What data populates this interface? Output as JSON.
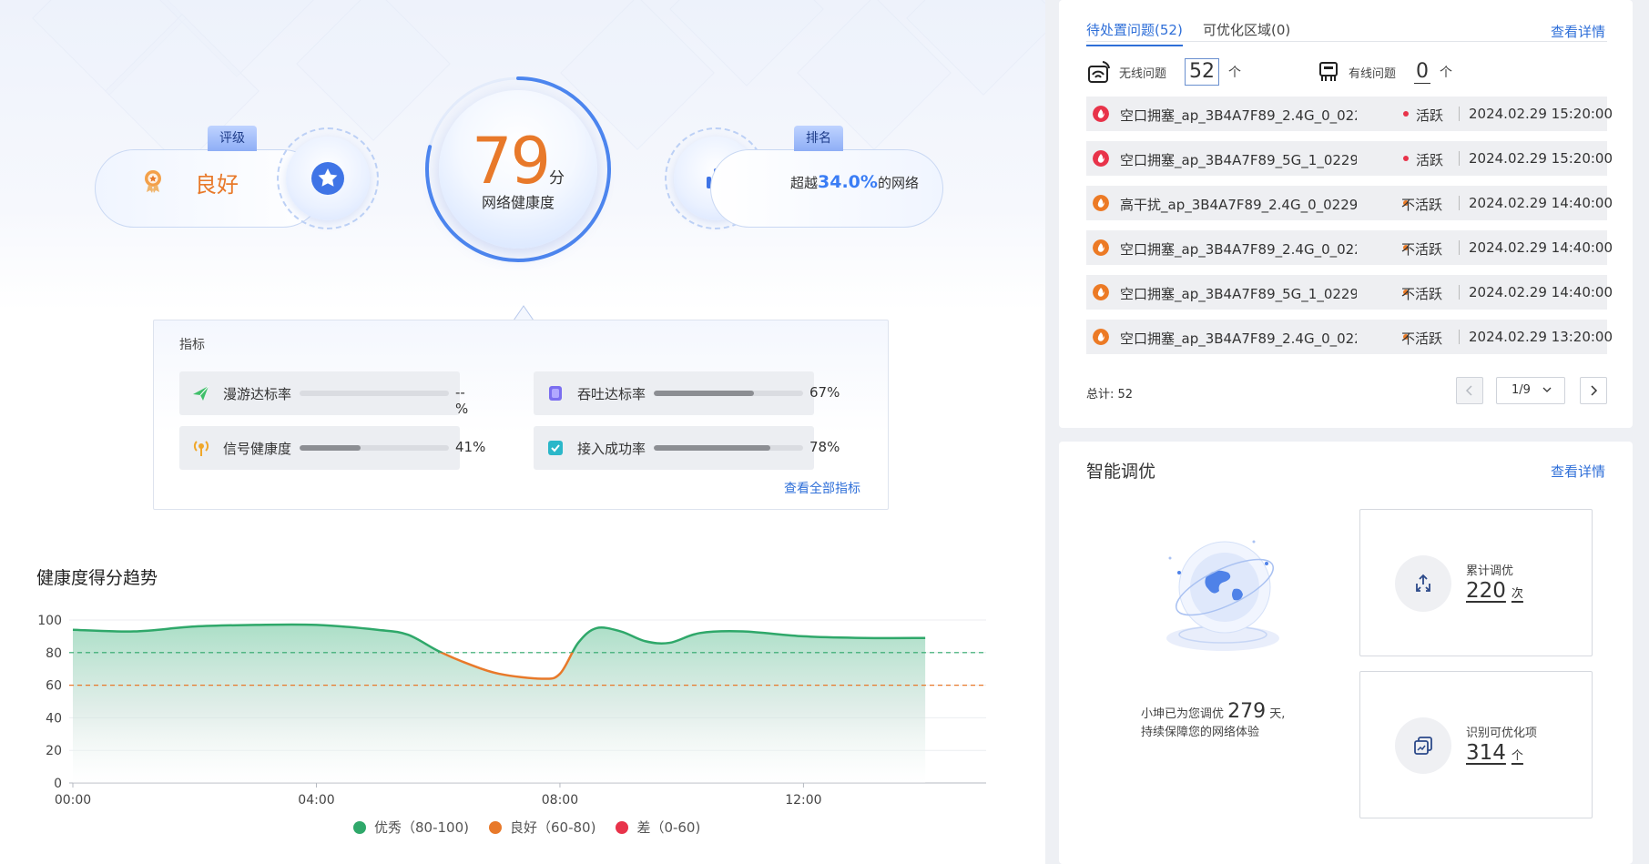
{
  "health": {
    "rating_tag": "评级",
    "rating_value": "良好",
    "score": "79",
    "score_unit": "分",
    "score_label": "网络健康度",
    "rank_tag": "排名",
    "rank_prefix": "超越",
    "rank_percent": "34.0%",
    "rank_suffix": "的网络",
    "score_ring_fraction": 0.79
  },
  "metrics": {
    "title": "指标",
    "items": [
      {
        "label": "漫游达标率",
        "value": "--%",
        "fill": 0,
        "icon": "roaming-icon"
      },
      {
        "label": "吞吐达标率",
        "value": "67%",
        "fill": 0.67,
        "icon": "throughput-icon"
      },
      {
        "label": "信号健康度",
        "value": "41%",
        "fill": 0.41,
        "icon": "signal-icon"
      },
      {
        "label": "接入成功率",
        "value": "78%",
        "fill": 0.78,
        "icon": "access-icon"
      }
    ],
    "view_all": "查看全部指标"
  },
  "trend": {
    "title": "健康度得分趋势",
    "legend": [
      {
        "label": "优秀（80-100)",
        "color": "#2fa86a"
      },
      {
        "label": "良好（60-80)",
        "color": "#e8792a"
      },
      {
        "label": "差（0-60)",
        "color": "#e8334a"
      }
    ]
  },
  "chart_data": {
    "type": "area",
    "x_ticks": [
      "00:00",
      "04:00",
      "08:00",
      "12:00"
    ],
    "y_ticks": [
      0,
      20,
      40,
      60,
      80,
      100
    ],
    "ylim": [
      0,
      100
    ],
    "x_hours": [
      0,
      1,
      2,
      3,
      4,
      5,
      5.5,
      6,
      6.5,
      7,
      7.7,
      8,
      8.3,
      8.6,
      9,
      9.4,
      9.8,
      10.3,
      11,
      12,
      13,
      14
    ],
    "y": [
      94,
      93,
      96,
      97,
      97,
      94,
      91,
      81,
      73,
      67,
      64,
      67,
      86,
      95,
      93,
      87,
      86,
      92,
      93,
      90,
      89,
      89
    ],
    "reference_lines": [
      80,
      60
    ],
    "xlim_hours": [
      0,
      15
    ]
  },
  "issues": {
    "tabs": [
      "待处置问题(52)",
      "可优化区域(0)"
    ],
    "detail_link": "查看详情",
    "wireless_label": "无线问题",
    "wireless_count": "52",
    "wired_label": "有线问题",
    "wired_count": "0",
    "unit": "个",
    "rows": [
      {
        "name": "空口拥塞_ap_3B4A7F89_2.4G_0_022...",
        "status": "活跃",
        "time": "2024.02.29 15:20:00",
        "severity_color": "#e8334a"
      },
      {
        "name": "空口拥塞_ap_3B4A7F89_5G_1_0229...",
        "status": "活跃",
        "time": "2024.02.29 15:20:00",
        "severity_color": "#e8334a"
      },
      {
        "name": "高干扰_ap_3B4A7F89_2.4G_0_0229...",
        "status": "不活跃",
        "time": "2024.02.29 14:40:00",
        "severity_color": "#ec7a25"
      },
      {
        "name": "空口拥塞_ap_3B4A7F89_2.4G_0_022...",
        "status": "不活跃",
        "time": "2024.02.29 14:40:00",
        "severity_color": "#ec7a25"
      },
      {
        "name": "空口拥塞_ap_3B4A7F89_5G_1_0229...",
        "status": "不活跃",
        "time": "2024.02.29 14:40:00",
        "severity_color": "#ec7a25"
      },
      {
        "name": "空口拥塞_ap_3B4A7F89_2.4G_0_022...",
        "status": "不活跃",
        "time": "2024.02.29 13:20:00",
        "severity_color": "#ec7a25"
      }
    ],
    "total": "总计: 52",
    "page": "1/9"
  },
  "tuning": {
    "title": "智能调优",
    "detail_link": "查看详情",
    "days_prefix": "小坤已为您调优",
    "days": "279",
    "days_suffix": "天,",
    "days_line2": "持续保障您的网络体验",
    "cumulative_label": "累计调优",
    "cumulative_value": "220",
    "cumulative_unit": "次",
    "identified_label": "识别可优化项",
    "identified_value": "314",
    "identified_unit": "个"
  },
  "colors": {
    "accent_blue": "#2f6fd8",
    "score_orange": "#e8792a",
    "good_green": "#2fa86a",
    "bad_red": "#e8334a"
  }
}
